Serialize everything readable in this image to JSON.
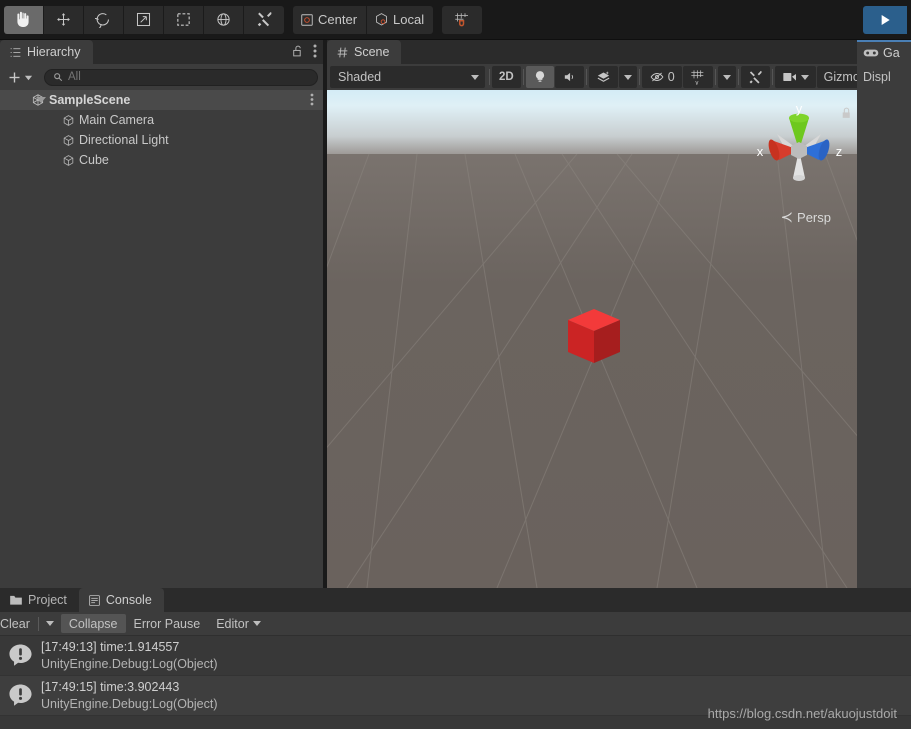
{
  "toolbar": {
    "tools": [
      {
        "name": "hand-tool",
        "icon": "hand-icon",
        "active": true
      },
      {
        "name": "move-tool",
        "icon": "move-arrows-icon",
        "active": false
      },
      {
        "name": "rotate-tool",
        "icon": "rotate-icon",
        "active": false
      },
      {
        "name": "scale-tool",
        "icon": "scale-icon",
        "active": false
      },
      {
        "name": "rect-tool",
        "icon": "rect-transform-icon",
        "active": false
      },
      {
        "name": "transform-tool",
        "icon": "move-rotate-scale-icon",
        "active": false
      },
      {
        "name": "custom-tool",
        "icon": "wrench-screwdriver-icon",
        "active": false
      }
    ],
    "pivot_label": "Center",
    "pivot_icon": "pivot-center-icon",
    "handle_label": "Local",
    "handle_icon": "handle-local-icon",
    "snap_icon": "grid-snap-magnet-icon",
    "play_icon": "play-triangle-icon"
  },
  "hierarchy": {
    "tab_label": "Hierarchy",
    "tab_icon": "hierarchy-icon",
    "lock_icon": "lock-open-icon",
    "menu_icon": "kebab-menu-icon",
    "add_label": "+",
    "search": {
      "value": "",
      "placeholder": "All",
      "icon": "search-icon"
    },
    "scene": {
      "name": "SampleScene",
      "icon": "unity-scene-icon",
      "expanded": true,
      "menu_icon": "kebab-menu-icon"
    },
    "objects": [
      {
        "label": "Main Camera",
        "icon": "gameobject-cube-icon"
      },
      {
        "label": "Directional Light",
        "icon": "gameobject-cube-icon"
      },
      {
        "label": "Cube",
        "icon": "gameobject-cube-icon"
      }
    ]
  },
  "scene_view": {
    "tab_label": "Scene",
    "tab_icon": "scene-hash-icon",
    "menu_icon": "kebab-menu-icon",
    "draw_mode": "Shaded",
    "mode_2d_label": "2D",
    "lighting_icon": "lightbulb-icon",
    "audio_icon": "speaker-icon",
    "fx_icon": "effects-layers-icon",
    "fx_caret_icon": "chevron-down-icon",
    "hidden_label": "0",
    "hidden_icon": "eye-off-icon",
    "grid_icon": "grid-y-icon",
    "grid_caret_icon": "chevron-down-icon",
    "tools_icon": "wrench-screwdriver-icon",
    "camera_icon": "scene-camera-icon",
    "camera_caret_icon": "chevron-down-icon",
    "gizmos_label": "Gizmos",
    "lock_icon": "lock-closed-icon",
    "projection_label": "Persp",
    "projection_caret": "≺",
    "axis_gizmo": {
      "y_label": "y",
      "x_label": "x",
      "z_label": "z",
      "y_color": "#6ec81e",
      "x_color": "#d73c2c",
      "z_color": "#2d6fd8",
      "center_color": "#b9b9b9"
    },
    "cube_object": {
      "top_color": "#f13b3b",
      "left_color": "#cc2424",
      "right_color": "#a01d1d"
    },
    "sky_top_color": "#d4ecf6",
    "sky_horizon_color": "#9e9a97",
    "ground_color": "#6b645f",
    "grid_line_color": "#8d8781"
  },
  "game_view": {
    "tab_label": "Ga",
    "tab_icon": "gamepad-icon",
    "display_label": "Displ"
  },
  "console": {
    "project_tab": {
      "label": "Project",
      "icon": "folder-icon"
    },
    "console_tab": {
      "label": "Console",
      "icon": "console-lines-icon"
    },
    "clear_label": "Clear",
    "clear_caret_icon": "chevron-down-icon",
    "collapse_label": "Collapse",
    "collapse_pressed": true,
    "error_pause_label": "Error Pause",
    "editor_label": "Editor",
    "editor_caret_icon": "chevron-down-icon",
    "messages": [
      {
        "icon": "info-bubble-icon",
        "line1": "[17:49:13] time:1.914557",
        "line2": "UnityEngine.Debug:Log(Object)"
      },
      {
        "icon": "info-bubble-icon",
        "line1": "[17:49:15] time:3.902443",
        "line2": "UnityEngine.Debug:Log(Object)"
      }
    ]
  },
  "watermark": {
    "text": "https://blog.csdn.net/akuojustdoit"
  }
}
